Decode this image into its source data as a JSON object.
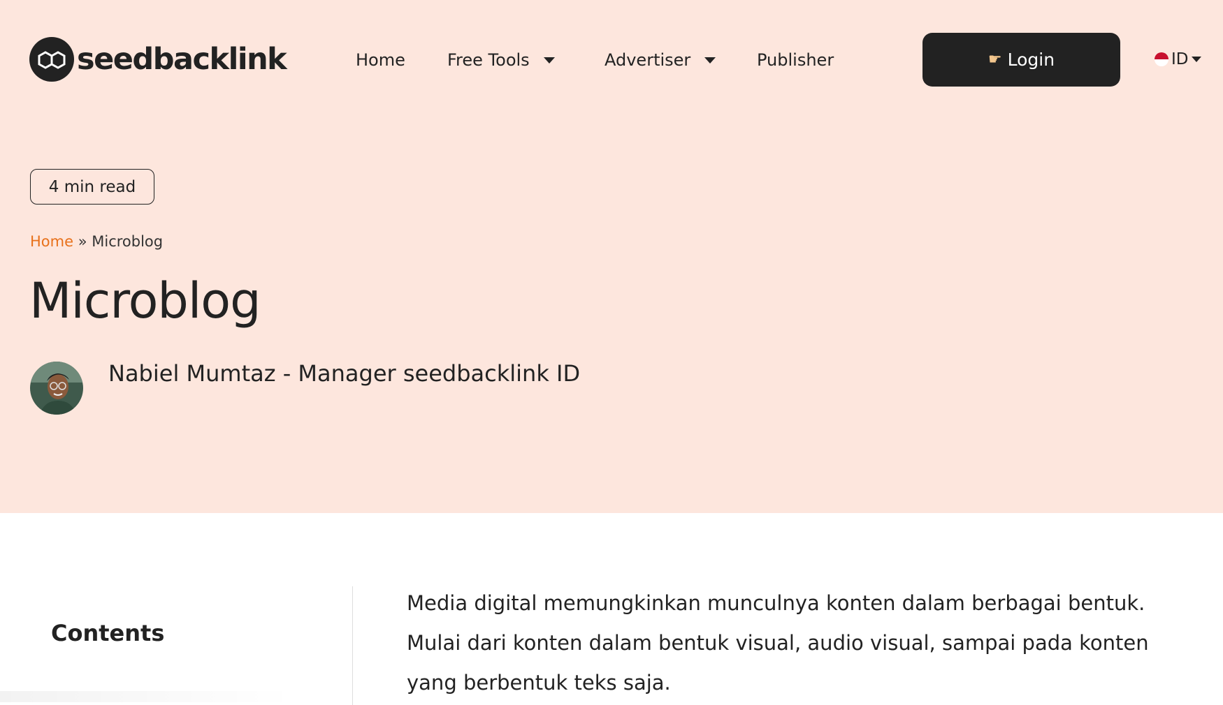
{
  "header": {
    "logo_text": "seedbacklink",
    "nav": [
      {
        "label": "Home",
        "has_dropdown": false
      },
      {
        "label": "Free Tools",
        "has_dropdown": true
      },
      {
        "label": "Advertiser",
        "has_dropdown": true
      },
      {
        "label": "Publisher",
        "has_dropdown": false
      }
    ],
    "login_label": "Login",
    "language": "ID"
  },
  "hero": {
    "read_time": "4 min read",
    "breadcrumb": {
      "home": "Home",
      "separator": "»",
      "current": "Microblog"
    },
    "title": "Microblog",
    "author": "Nabiel Mumtaz - Manager seedbacklink ID"
  },
  "content": {
    "contents_heading": "Contents",
    "intro": "Media digital memungkinkan munculnya konten dalam berbagai bentuk. Mulai dari konten dalam bentuk visual, audio visual, sampai pada konten yang berbentuk teks saja."
  },
  "colors": {
    "hero_background": "#fde6dd",
    "dark": "#222222",
    "accent": "#e8711b",
    "login_hand": "#f3c68d"
  },
  "icons": [
    "chain-link-logo-icon",
    "chevron-down-icon",
    "pointing-hand-icon",
    "indonesia-flag-icon",
    "author-avatar"
  ]
}
